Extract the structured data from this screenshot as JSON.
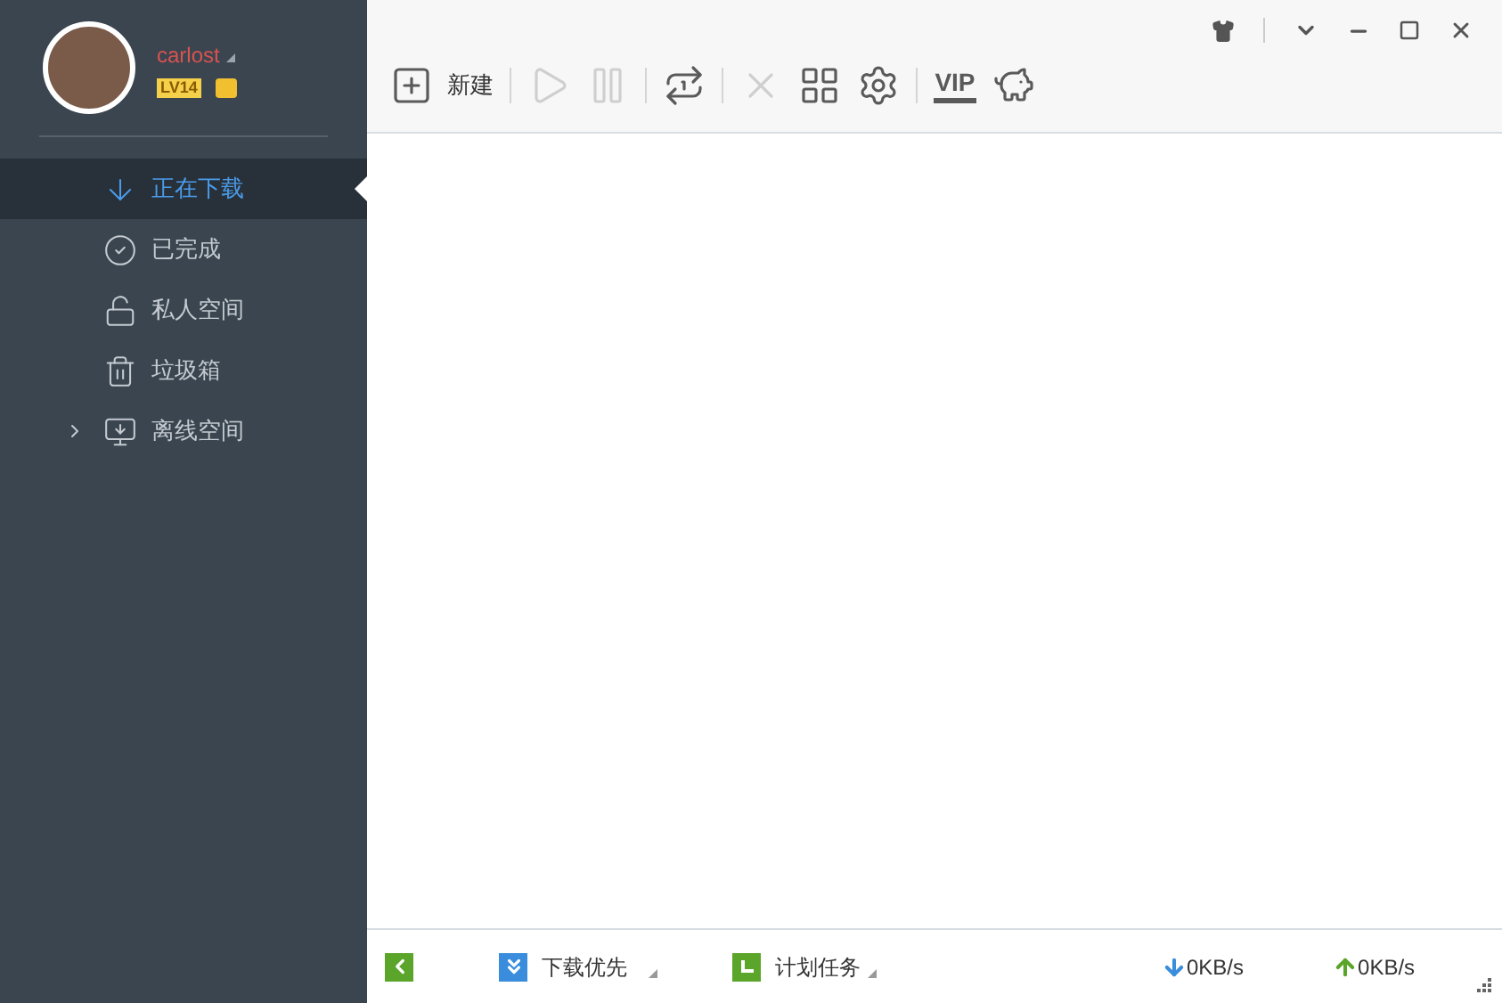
{
  "user": {
    "name": "carlost",
    "level": "LV14"
  },
  "nav": [
    {
      "kind": "downloading",
      "label": "正在下载",
      "selected": true
    },
    {
      "kind": "completed",
      "label": "已完成",
      "selected": false
    },
    {
      "kind": "private",
      "label": "私人空间",
      "selected": false
    },
    {
      "kind": "trash",
      "label": "垃圾箱",
      "selected": false
    },
    {
      "kind": "offline",
      "label": "离线空间",
      "selected": false,
      "expanded": false
    }
  ],
  "toolbar": [
    {
      "kind": "new",
      "label": "新建",
      "disabled": false
    },
    {
      "kind": "start",
      "disabled": true
    },
    {
      "kind": "pause",
      "disabled": true
    },
    {
      "kind": "once",
      "disabled": false
    },
    {
      "kind": "delete",
      "disabled": true
    },
    {
      "kind": "grid",
      "disabled": false
    },
    {
      "kind": "settings",
      "disabled": false
    },
    {
      "kind": "vip",
      "label": "VIP",
      "disabled": false
    },
    {
      "kind": "piggy",
      "disabled": false
    }
  ],
  "status_bar": {
    "priority": "下载优先",
    "schedule": "计划任务",
    "down_speed": "0KB/s",
    "up_speed": "0KB/s"
  }
}
